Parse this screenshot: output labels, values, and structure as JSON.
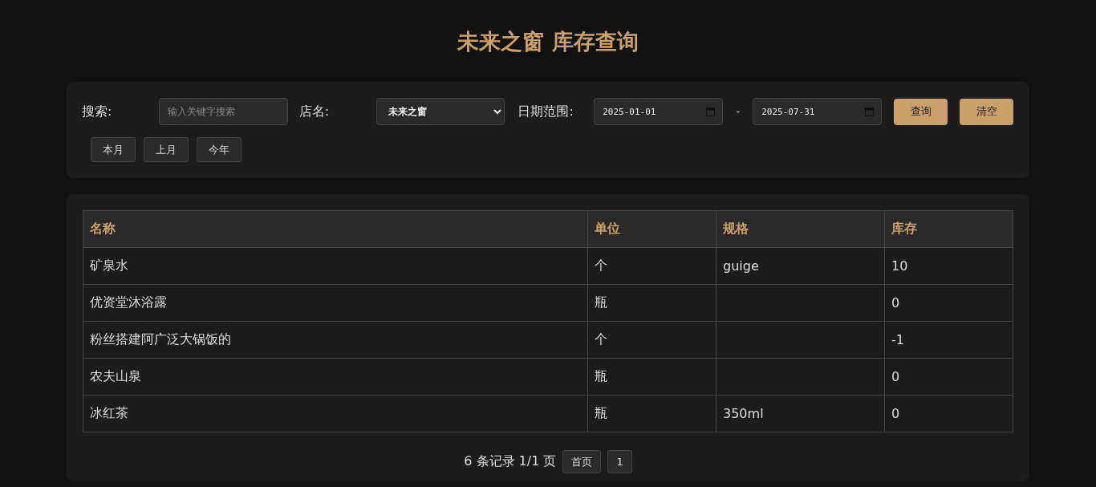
{
  "title": "未来之窗 库存查询",
  "filters": {
    "search_label": "搜索:",
    "search": {
      "placeholder": "输入关键字搜索"
    },
    "shop_label": "店名:",
    "shop": {
      "value": "未来之窗"
    },
    "date_label": "日期范围:",
    "date_from": "2025-01-01",
    "date_sep": "-",
    "date_to": "2025-07-31",
    "buttons": [
      "查询",
      "清空"
    ],
    "quick_ranges": [
      "本月",
      "上月",
      "今年"
    ]
  },
  "table": {
    "columns": [
      "名称",
      "单位",
      "规格",
      "库存"
    ],
    "rows": [
      [
        "矿泉水",
        "个",
        "guige",
        "10"
      ],
      [
        "优资堂沐浴露",
        "瓶",
        "",
        "0"
      ],
      [
        "粉丝搭建阿广泛大锅饭的",
        "个",
        "",
        "-1"
      ],
      [
        "农夫山泉",
        "瓶",
        "",
        "0"
      ],
      [
        "冰红茶",
        "瓶",
        "350ml",
        "0"
      ]
    ]
  },
  "pagination": {
    "summary": "6 条记录 1/1 页",
    "first": "首页",
    "pages": [
      "1"
    ]
  }
}
